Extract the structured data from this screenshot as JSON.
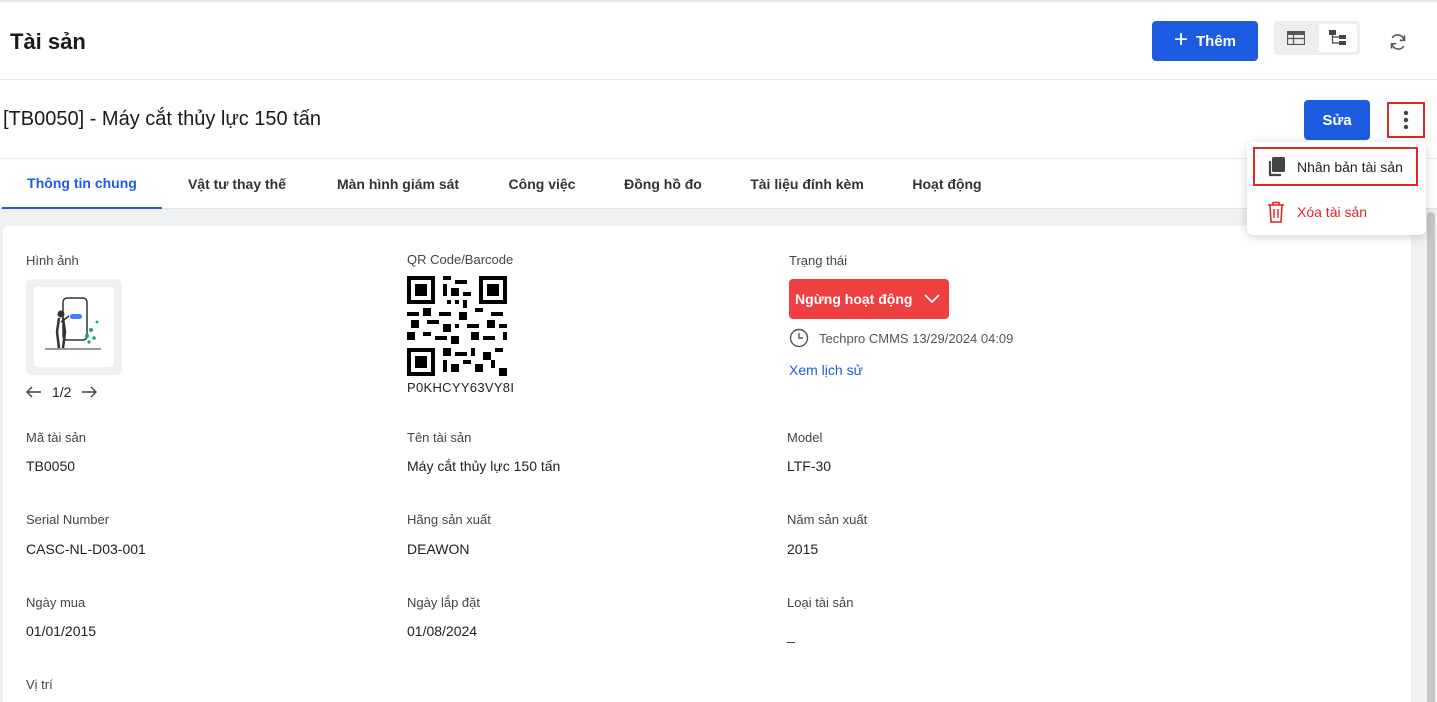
{
  "header": {
    "title": "Tài sản",
    "add_label": "Thêm",
    "add_icon": "plus-icon",
    "view_icons": [
      "table-view-icon",
      "tree-view-icon"
    ],
    "refresh_icon": "refresh-icon"
  },
  "asset": {
    "title": "[TB0050] - Máy cắt thủy lực 150 tấn",
    "edit_label": "Sửa",
    "more_icon": "more-vertical-icon"
  },
  "menu": {
    "duplicate_label": "Nhân bản tài sản",
    "delete_label": "Xóa tài sản",
    "delete_color": "#e52521"
  },
  "tabs": [
    {
      "label": "Thông tin chung",
      "active": true
    },
    {
      "label": "Vật tư thay thế"
    },
    {
      "label": "Màn hình giám sát"
    },
    {
      "label": "Công việc"
    },
    {
      "label": "Đồng hồ đo"
    },
    {
      "label": "Tài liệu đính kèm"
    },
    {
      "label": "Hoạt động"
    }
  ],
  "details": {
    "image_label": "Hình ảnh",
    "image_pager": "1/2",
    "qr_label": "QR Code/Barcode",
    "qr_value": "P0KHCYY63VY8I",
    "status_label": "Trạng thái",
    "status_value": "Ngừng hoạt động",
    "status_color": "#ee4040",
    "status_meta": "Techpro CMMS 13/29/2024 04:09",
    "history_link": "Xem lịch sử",
    "fields": [
      {
        "label": "Mã tài sản",
        "value": "TB0050"
      },
      {
        "label": "Tên tài sản",
        "value": "Máy cắt thủy lực 150 tấn"
      },
      {
        "label": "Model",
        "value": "LTF-30"
      },
      {
        "label": "Serial Number",
        "value": "CASC-NL-D03-001"
      },
      {
        "label": "Hãng sản xuất",
        "value": "DEAWON"
      },
      {
        "label": "Năm sản xuất",
        "value": "2015"
      },
      {
        "label": "Ngày mua",
        "value": "01/01/2015"
      },
      {
        "label": "Ngày lắp đặt",
        "value": "01/08/2024"
      },
      {
        "label": "Loại tài sản",
        "value": "_"
      },
      {
        "label": "Vị trí",
        "value": ""
      }
    ]
  },
  "accent_color": "#1d5ce0"
}
